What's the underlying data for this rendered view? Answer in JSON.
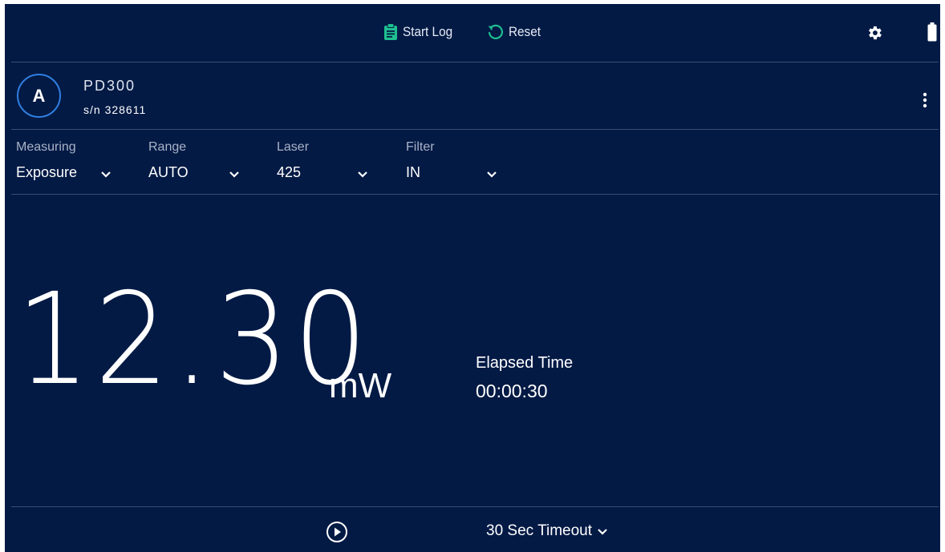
{
  "toolbar": {
    "start_log_label": "Start Log",
    "reset_label": "Reset",
    "accent_color": "#1fbf8f"
  },
  "device": {
    "channel": "A",
    "model": "PD300",
    "serial": "s/n 328611"
  },
  "settings": [
    {
      "caption": "Measuring",
      "value": "Exposure"
    },
    {
      "caption": "Range",
      "value": "AUTO"
    },
    {
      "caption": "Laser",
      "value": "425"
    },
    {
      "caption": "Filter",
      "value": "IN"
    }
  ],
  "reading": {
    "value": "12.30",
    "unit": "mW"
  },
  "elapsed": {
    "label": "Elapsed Time",
    "value": "00:00:30"
  },
  "footer": {
    "timeout_label": "30 Sec Timeout"
  },
  "icons": {
    "start_log": "clipboard-icon",
    "reset": "refresh-icon",
    "settings": "gear-icon",
    "battery": "battery-icon",
    "more": "vertical-dots-icon",
    "play": "play-circle-icon",
    "dropdown": "chevron-down-icon"
  },
  "colors": {
    "background": "#031a45",
    "divider": "#3b4d72",
    "avatar_ring": "#2f7fe0"
  }
}
